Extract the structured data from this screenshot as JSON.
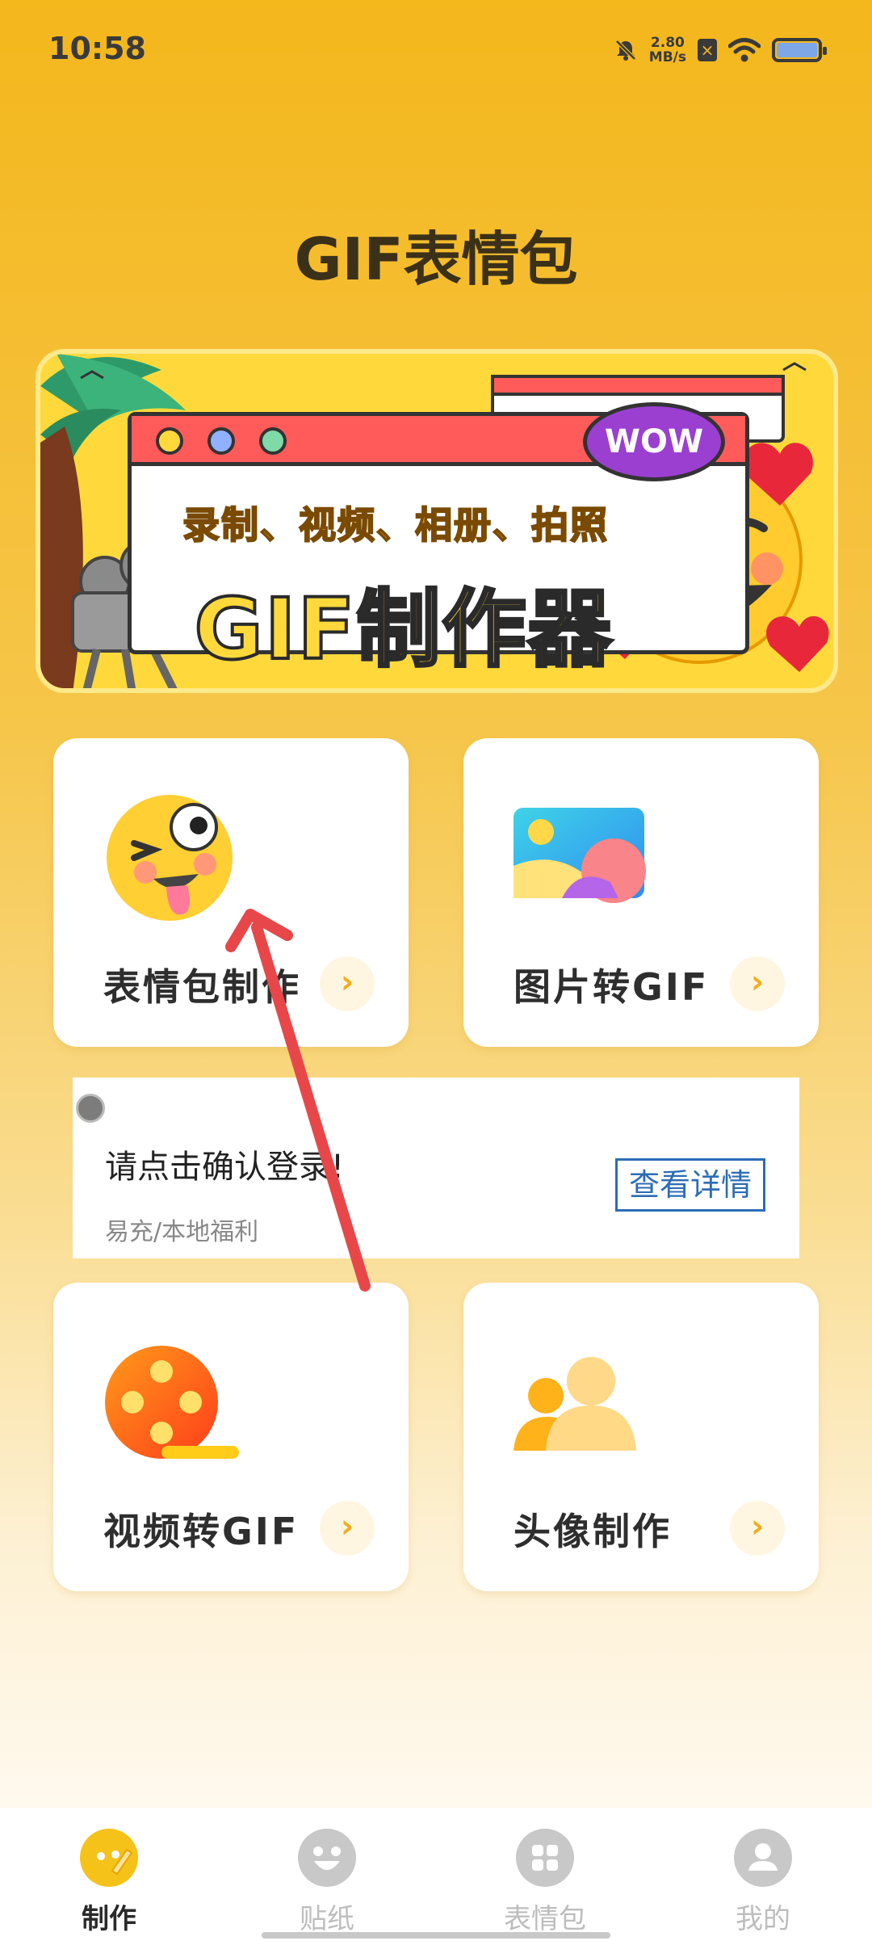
{
  "status_bar": {
    "time": "10:58",
    "net_speed_value": "2.80",
    "net_speed_unit": "MB/s"
  },
  "header": {
    "title": "GIF表情包"
  },
  "banner": {
    "subtitle": "录制、视频、相册、拍照",
    "main_text": "GIF制作器",
    "bubble_text": "WOW"
  },
  "features": [
    {
      "label": "表情包制作",
      "icon": "emoji-wink-icon"
    },
    {
      "label": "图片转GIF",
      "icon": "image-icon"
    },
    {
      "label": "视频转GIF",
      "icon": "film-reel-icon"
    },
    {
      "label": "头像制作",
      "icon": "avatar-users-icon"
    }
  ],
  "ad": {
    "title": "请点击确认登录!",
    "subtitle": "易充/本地福利",
    "button": "查看详情"
  },
  "nav": [
    {
      "label": "制作",
      "icon": "make-icon",
      "active": true
    },
    {
      "label": "贴纸",
      "icon": "smile-icon",
      "active": false
    },
    {
      "label": "表情包",
      "icon": "grid-icon",
      "active": false
    },
    {
      "label": "我的",
      "icon": "profile-icon",
      "active": false
    }
  ],
  "colors": {
    "accent": "#f5c21a",
    "arrow_annotation": "#e8474a",
    "link": "#2c6cb6"
  }
}
